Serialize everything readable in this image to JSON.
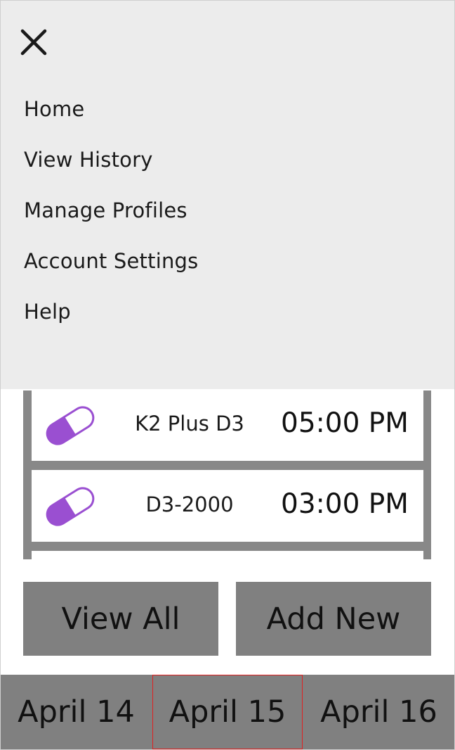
{
  "menu": {
    "items": [
      {
        "label": "Home"
      },
      {
        "label": "View History"
      },
      {
        "label": "Manage Profiles"
      },
      {
        "label": "Account Settings"
      },
      {
        "label": "Help"
      }
    ]
  },
  "medications": [
    {
      "name": "K2 Plus D3",
      "time": "05:00 PM",
      "icon": "capsule-icon"
    },
    {
      "name": "D3-2000",
      "time": "03:00 PM",
      "icon": "capsule-icon"
    }
  ],
  "actions": {
    "view_all": "View All",
    "add_new": "Add New"
  },
  "dates": {
    "prev": "April 14",
    "current": "April 15",
    "next": "April 16"
  },
  "colors": {
    "pill_accent": "#9a4fd1",
    "drawer_bg": "#ececec",
    "button_gray": "#808080",
    "selected_border": "#e02020"
  }
}
